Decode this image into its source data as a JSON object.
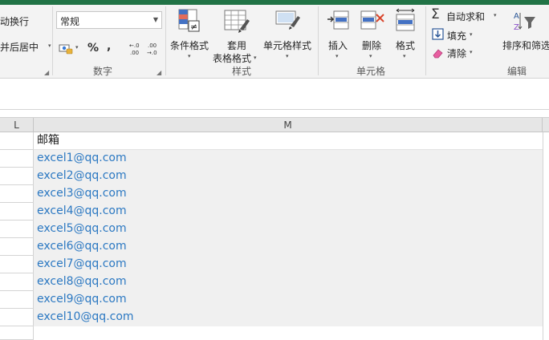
{
  "ribbon": {
    "alignment": {
      "wrap_text": "动换行",
      "merge_center": "并后居中",
      "merge_dropdown": "▾"
    },
    "number": {
      "format_value": "常规",
      "percent": "%",
      "comma": ",",
      "group_label": "数字"
    },
    "styles": {
      "conditional_line1": "条件格式",
      "table_line1": "套用",
      "table_line2": "表格格式",
      "cell_styles": "单元格样式",
      "group_label": "样式"
    },
    "cells": {
      "insert": "插入",
      "delete": "删除",
      "format": "格式",
      "group_label": "单元格"
    },
    "editing": {
      "autosum": "自动求和",
      "fill": "填充",
      "clear": "清除",
      "sort_filter": "排序和筛选",
      "group_label": "编辑"
    }
  },
  "sheet": {
    "columns": [
      "L",
      "M"
    ],
    "header_cell": "邮箱",
    "rows": [
      "excel1@qq.com",
      "excel2@qq.com",
      "excel3@qq.com",
      "excel4@qq.com",
      "excel5@qq.com",
      "excel6@qq.com",
      "excel7@qq.com",
      "excel8@qq.com",
      "excel9@qq.com",
      "excel10@qq.com"
    ]
  },
  "colors": {
    "brand": "#217346",
    "link_text": "#2b78c2"
  }
}
